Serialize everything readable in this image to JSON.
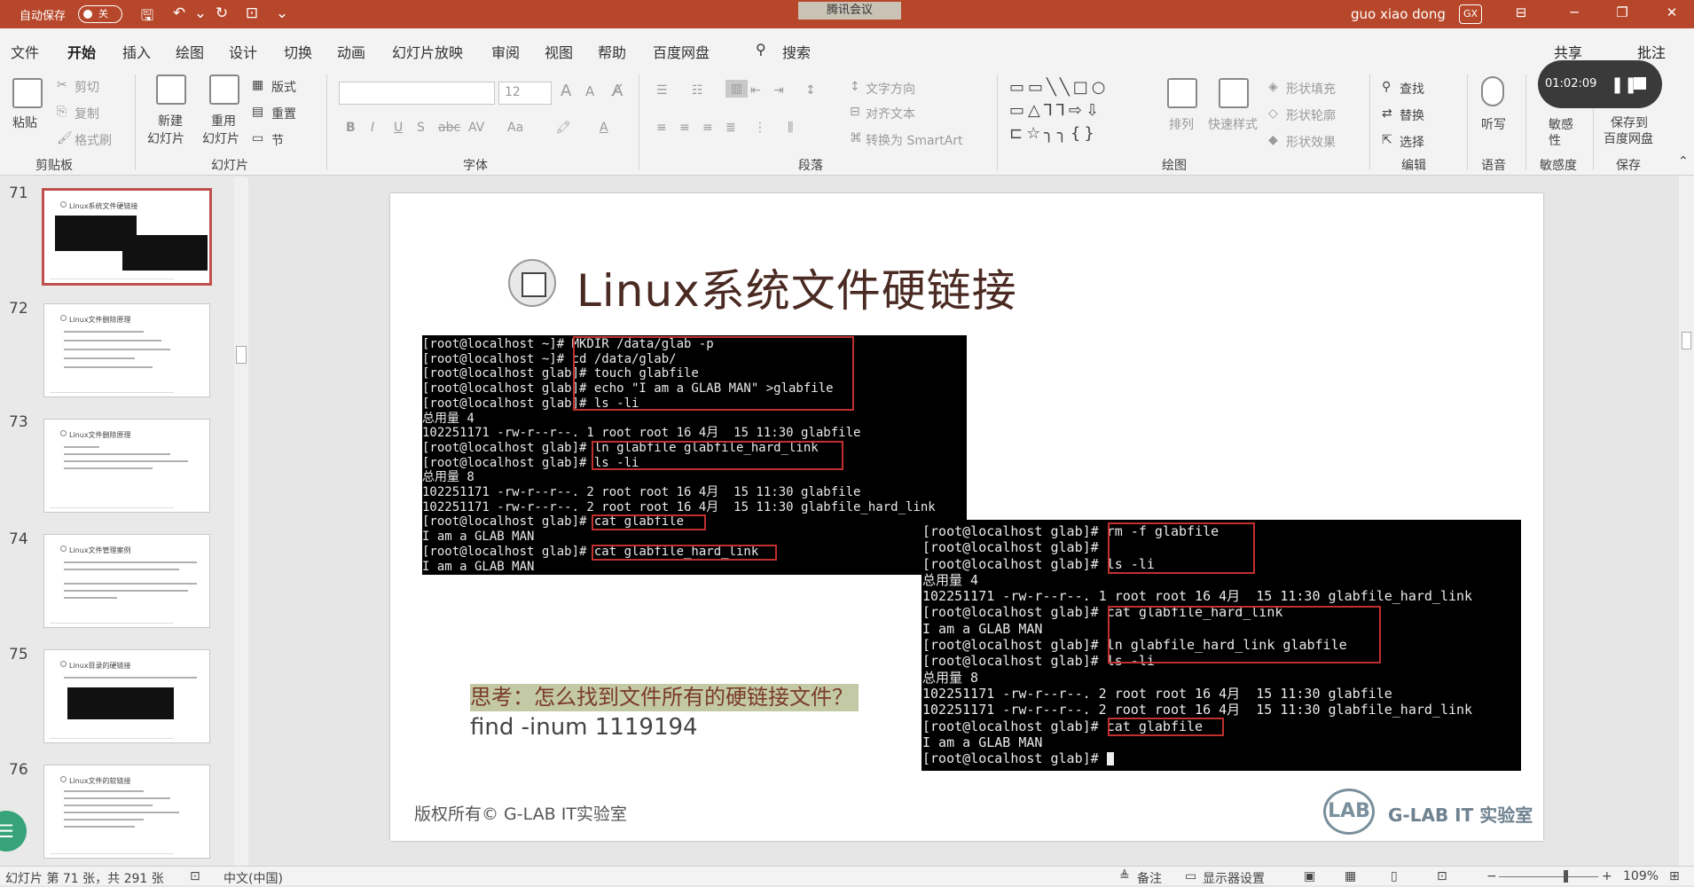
{
  "titlebar": {
    "autosave_label": "自动保存",
    "autosave_state": "关",
    "doc_title": "腾讯会议",
    "user_name": "guo xiao dong",
    "user_initials": "GX",
    "icons": [
      "save-icon",
      "undo-icon",
      "redo-icon",
      "present-icon",
      "customize-icon",
      "ribbon-display-icon",
      "minimize-icon",
      "restore-icon",
      "close-icon"
    ]
  },
  "tabs": {
    "items": [
      "文件",
      "开始",
      "插入",
      "绘图",
      "设计",
      "切换",
      "动画",
      "幻灯片放映",
      "审阅",
      "视图",
      "帮助",
      "百度网盘"
    ],
    "active": "开始",
    "search": "搜索",
    "share": "共享",
    "comment": "批注"
  },
  "ribbon": {
    "clipboard": {
      "paste": "粘贴",
      "cut": "剪切",
      "copy": "复制",
      "format_painter": "格式刷",
      "group": "剪贴板"
    },
    "slides": {
      "new_slide": "新建",
      "new_slide2": "幻灯片",
      "reuse": "重用",
      "reuse2": "幻灯片",
      "layout": "版式",
      "reset": "重置",
      "section": "节",
      "group": "幻灯片"
    },
    "font": {
      "group": "字体",
      "size": "12"
    },
    "paragraph": {
      "text_direction": "文字方向",
      "align_text": "对齐文本",
      "smartart": "转换为 SmartArt",
      "group": "段落"
    },
    "drawing": {
      "arrange": "排列",
      "quick_styles": "快速样式",
      "shape_fill": "形状填充",
      "shape_outline": "形状轮廓",
      "shape_effects": "形状效果",
      "group": "绘图"
    },
    "editing": {
      "find": "查找",
      "replace": "替换",
      "select": "选择",
      "group": "编辑"
    },
    "voice": {
      "dictate": "听写",
      "group": "语音"
    },
    "sensitivity": {
      "label": "敏感",
      "label2": "性",
      "group": "敏感度"
    },
    "save": {
      "save_to": "保存到",
      "baidu": "百度网盘",
      "group": "保存"
    },
    "recording_time": "01:02:09"
  },
  "thumbnails": [
    {
      "num": "71",
      "title": "Linux系统文件硬链接",
      "selected": true
    },
    {
      "num": "72",
      "title": "Linux文件删除原理",
      "selected": false
    },
    {
      "num": "73",
      "title": "Linux文件删除原理",
      "selected": false
    },
    {
      "num": "74",
      "title": "Linux文件管理案例",
      "selected": false
    },
    {
      "num": "75",
      "title": "Linux目录的硬链接",
      "selected": false
    },
    {
      "num": "76",
      "title": "Linux文件的软链接",
      "selected": false
    }
  ],
  "slide": {
    "title": "Linux系统文件硬链接",
    "terminal1": [
      "[root@localhost ~]# MKDIR /data/glab -p",
      "[root@localhost ~]# cd /data/glab/",
      "[root@localhost glab]# touch glabfile",
      "[root@localhost glab]# echo \"I am a GLAB MAN\" >glabfile",
      "[root@localhost glab]# ls -li",
      "总用量 4",
      "102251171 -rw-r--r--. 1 root root 16 4月  15 11:30 glabfile",
      "[root@localhost glab]# ln glabfile glabfile_hard_link",
      "[root@localhost glab]# ls -li",
      "总用量 8",
      "102251171 -rw-r--r--. 2 root root 16 4月  15 11:30 glabfile",
      "102251171 -rw-r--r--. 2 root root 16 4月  15 11:30 glabfile_hard_link",
      "[root@localhost glab]# cat glabfile",
      "I am a GLAB MAN",
      "[root@localhost glab]# cat glabfile_hard_link",
      "I am a GLAB MAN"
    ],
    "terminal2": [
      "[root@localhost glab]# rm -f glabfile",
      "[root@localhost glab]#",
      "[root@localhost glab]# ls -li",
      "总用量 4",
      "102251171 -rw-r--r--. 1 root root 16 4月  15 11:30 glabfile_hard_link",
      "[root@localhost glab]# cat glabfile_hard_link",
      "I am a GLAB MAN",
      "[root@localhost glab]# ln glabfile_hard_link glabfile",
      "[root@localhost glab]# ls -li",
      "总用量 8",
      "102251171 -rw-r--r--. 2 root root 16 4月  15 11:30 glabfile",
      "102251171 -rw-r--r--. 2 root root 16 4月  15 11:30 glabfile_hard_link",
      "[root@localhost glab]# cat glabfile",
      "I am a GLAB MAN",
      "[root@localhost glab]# "
    ],
    "question": "思考：怎么找到文件所有的硬链接文件？",
    "find_command": "find -inum 1119194",
    "copyright": "版权所有© G-LAB IT实验室",
    "logo_text": "LAB",
    "brand": "G-LAB IT 实验室"
  },
  "statusbar": {
    "slide_info": "幻灯片 第 71 张，共 291 张",
    "language": "中文(中国)",
    "notes": "备注",
    "display_settings": "显示器设置",
    "zoom": "109%",
    "zoom_fraction": 0.65
  },
  "colors": {
    "accent": "#b7472a",
    "highlight_box": "#c0302e",
    "terminal_bg": "#000000",
    "question_bg": "#c3c9a5"
  }
}
